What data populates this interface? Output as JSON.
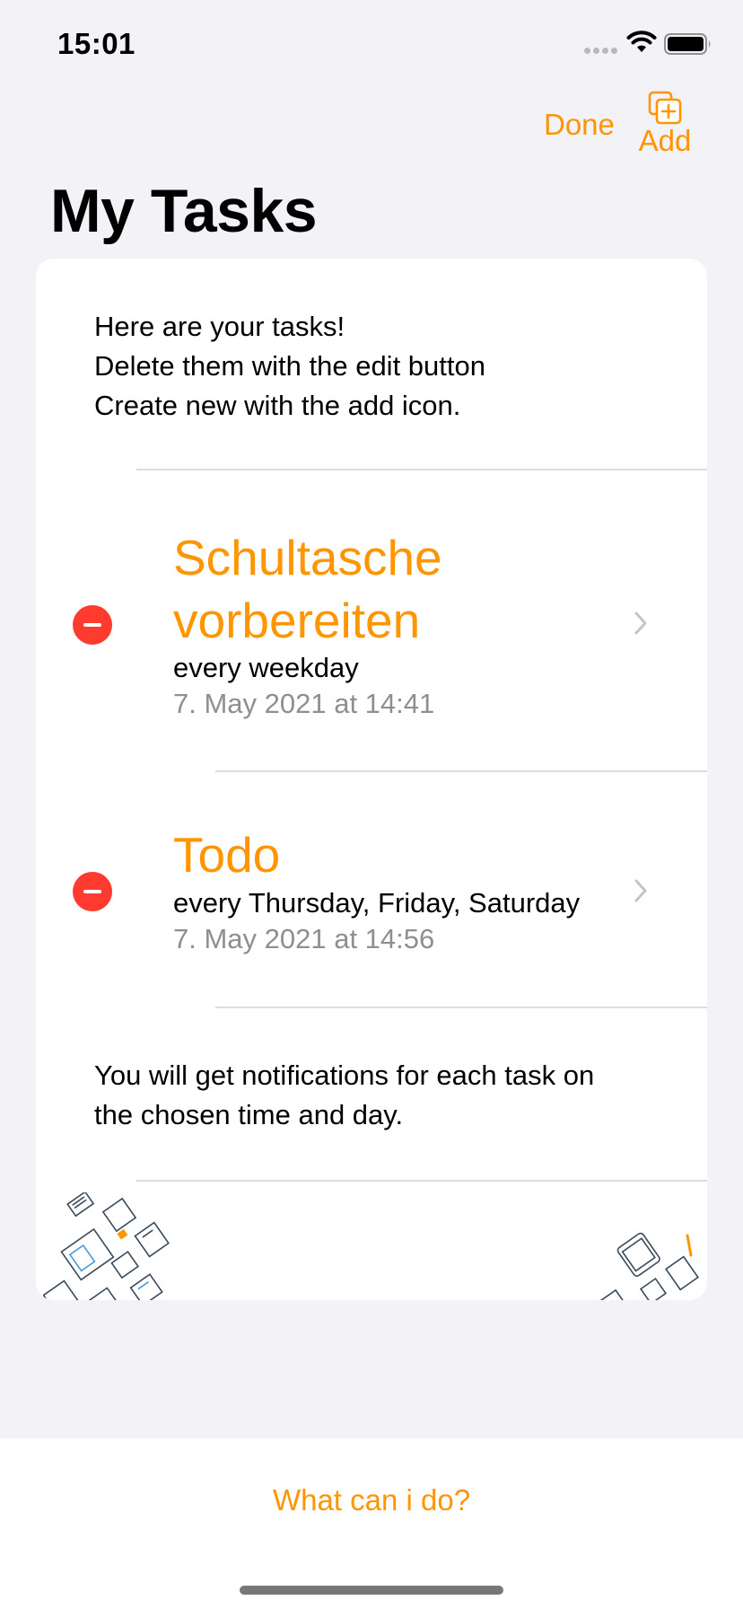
{
  "status": {
    "time": "15:01"
  },
  "nav": {
    "done_label": "Done",
    "add_label": "Add"
  },
  "page": {
    "title": "My Tasks"
  },
  "intro": {
    "line1": "Here are your tasks!",
    "line2": "Delete them with the edit button",
    "line3": "Create new with the add icon."
  },
  "tasks": [
    {
      "title_line1": "Schultasche",
      "title_line2": "vorbereiten",
      "repeat": "every weekday",
      "date": "7. May 2021 at 14:41"
    },
    {
      "title_line1": "Todo",
      "repeat": "every Thursday, Friday, Saturday",
      "date": "7. May 2021 at 14:56"
    }
  ],
  "footer": {
    "line1": "You will get notifications for each task on",
    "line2": "the chosen time and day."
  },
  "bottom": {
    "help_label": "What can i do?"
  },
  "colors": {
    "accent": "#ff9500",
    "delete": "#ff3b30",
    "secondary_text": "#8e8e93",
    "background": "#f2f2f7"
  },
  "icons": {
    "add": "plus-square-on-square-icon",
    "delete": "minus-circle-icon",
    "disclosure": "chevron-right-icon"
  }
}
